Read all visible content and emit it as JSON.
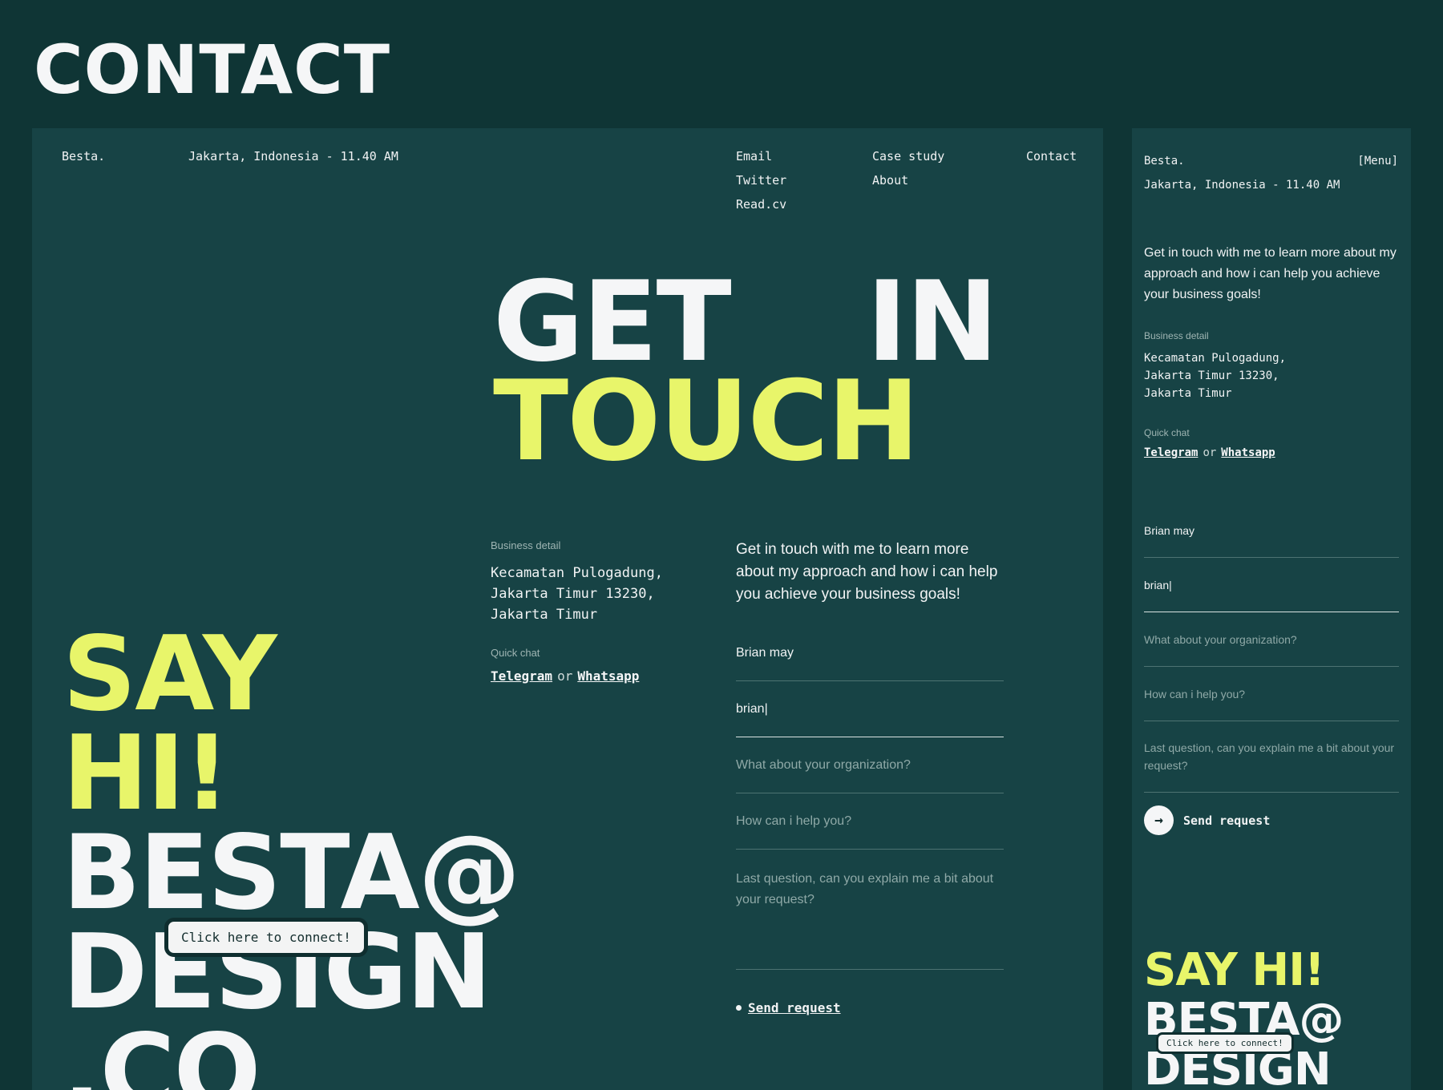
{
  "page_title": "CONTACT",
  "desktop": {
    "nav": {
      "brand": "Besta.",
      "location": "Jakarta, Indonesia - 11.40 AM",
      "col1": [
        "Email",
        "Twitter",
        "Read.cv"
      ],
      "col2": [
        "Case study",
        "About"
      ],
      "col3": [
        "Contact"
      ]
    },
    "hero": {
      "word1": "GET",
      "word2": "IN",
      "word3": "TOUCH"
    },
    "business_label": "Business detail",
    "business_address": [
      "Kecamatan Pulogadung,",
      "Jakarta Timur 13230,",
      "Jakarta Timur"
    ],
    "quick_chat_label": "Quick chat",
    "quick_chat": {
      "telegram": "Telegram",
      "or": "or",
      "whatsapp": "Whatsapp"
    },
    "intro": "Get in touch with me to learn more about my approach and how i can help you achieve your business goals!",
    "form": {
      "name_value": "Brian may",
      "email_value": "brian|",
      "org_placeholder": "What about your organization?",
      "help_placeholder": "How can i help you?",
      "request_placeholder": "Last question, can you explain me a bit about your request?"
    },
    "send_label": "Send request",
    "say_hi": {
      "line1": "SAY",
      "line2": "HI!",
      "line3": "BESTA@",
      "line4": "DESIGN",
      "line5": ".CO"
    },
    "connect_label": "Click here to connect!"
  },
  "mobile": {
    "brand": "Besta.",
    "menu": "[Menu]",
    "location": "Jakarta, Indonesia - 11.40 AM",
    "intro": "Get in touch with me to learn more about my approach and how i can help you achieve your business goals!",
    "business_label": "Business detail",
    "business_address": [
      "Kecamatan Pulogadung,",
      "Jakarta Timur 13230,",
      "Jakarta Timur"
    ],
    "quick_chat_label": "Quick chat",
    "quick_chat": {
      "telegram": "Telegram",
      "or": "or",
      "whatsapp": "Whatsapp"
    },
    "form": {
      "name_value": "Brian may",
      "email_value": "brian|",
      "org_placeholder": "What about your organization?",
      "help_placeholder": "How can i help you?",
      "request_placeholder": "Last question, can you explain me a bit about your request?"
    },
    "send_label": "Send request",
    "send_icon": "arrow-right-icon",
    "say_hi": {
      "line1": "SAY HI!",
      "line2": "BESTA@",
      "line3": "DESIGN"
    },
    "connect_label": "Click here to connect!"
  },
  "colors": {
    "background": "#0f3535",
    "panel": "#174345",
    "accent": "#e8f56a",
    "text": "#f1f3f4"
  }
}
